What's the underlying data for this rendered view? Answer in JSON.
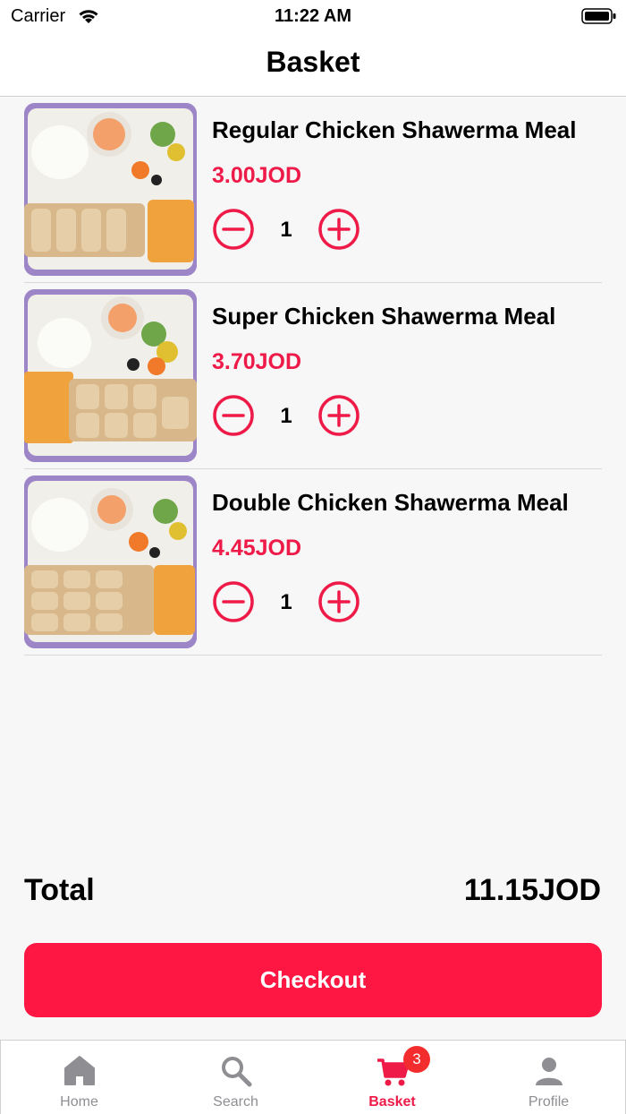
{
  "status_bar": {
    "carrier": "Carrier",
    "time": "11:22 AM"
  },
  "header": {
    "title": "Basket"
  },
  "items": [
    {
      "name": "Regular Chicken Shawerma Meal",
      "price": "3.00JOD",
      "quantity": "1"
    },
    {
      "name": "Super Chicken Shawerma Meal",
      "price": "3.70JOD",
      "quantity": "1"
    },
    {
      "name": "Double Chicken Shawerma Meal",
      "price": "4.45JOD",
      "quantity": "1"
    }
  ],
  "summary": {
    "total_label": "Total",
    "total_value": "11.15JOD"
  },
  "checkout": {
    "label": "Checkout"
  },
  "tabs": [
    {
      "label": "Home",
      "icon": "home-icon"
    },
    {
      "label": "Search",
      "icon": "search-icon"
    },
    {
      "label": "Basket",
      "icon": "cart-icon",
      "badge": "3",
      "active": true
    },
    {
      "label": "Profile",
      "icon": "person-icon"
    }
  ],
  "colors": {
    "accent": "#ff1744",
    "price": "#ee1a48",
    "badge": "#f32d2d",
    "inactive": "#8e8e93"
  }
}
